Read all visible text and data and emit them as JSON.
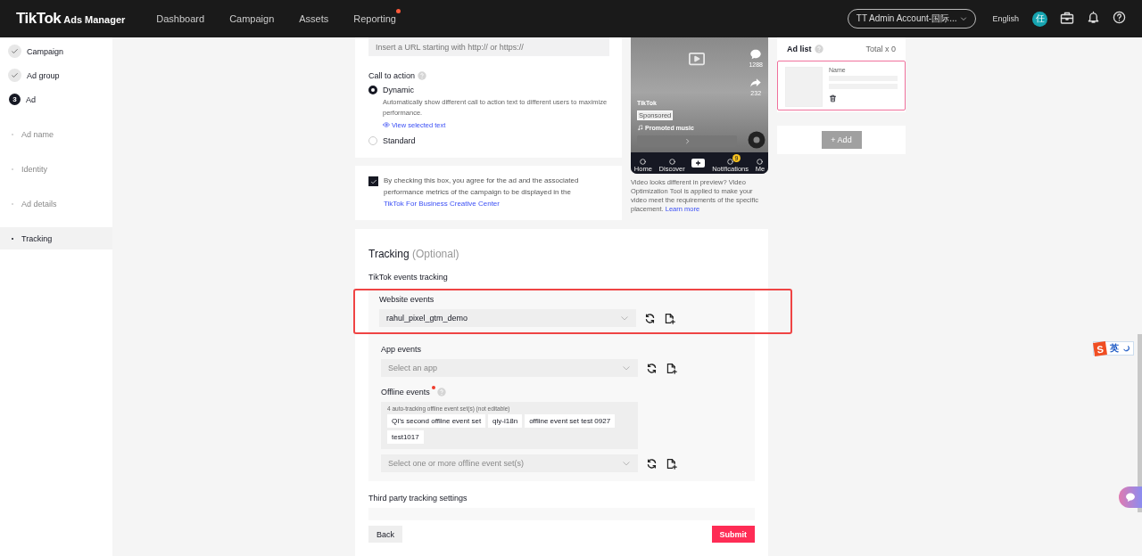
{
  "header": {
    "logo": "TikTok",
    "logo_suffix": "Ads Manager",
    "nav": [
      {
        "label": "Dashboard",
        "badge": false
      },
      {
        "label": "Campaign",
        "badge": false
      },
      {
        "label": "Assets",
        "badge": false
      },
      {
        "label": "Reporting",
        "badge": true
      }
    ],
    "account": "TT Admin Account-国际...",
    "language": "English",
    "avatar": "任"
  },
  "steps": [
    {
      "kind": "done",
      "label": "Campaign",
      "selected": false
    },
    {
      "kind": "done",
      "label": "Ad group",
      "selected": false
    },
    {
      "kind": "current",
      "number": "3",
      "label": "Ad",
      "selected": false
    },
    {
      "kind": "sub",
      "label": "Ad name",
      "selected": false
    },
    {
      "kind": "sub",
      "label": "Identity",
      "selected": false
    },
    {
      "kind": "sub",
      "label": "Ad details",
      "selected": false
    },
    {
      "kind": "sub",
      "label": "Tracking",
      "selected": true
    }
  ],
  "url_field": {
    "placeholder": "Insert a URL starting with http:// or https://"
  },
  "call_to_action": {
    "label": "Call to action",
    "options": [
      {
        "label": "Dynamic",
        "selected": true,
        "description": "Automatically show different call to action text to different users to maximize performance.",
        "link": "View selected text"
      },
      {
        "label": "Standard",
        "selected": false
      }
    ]
  },
  "consent": {
    "checked": true,
    "text": "By checking this box, you agree for the ad and the associated performance metrics of the campaign to be displayed in the",
    "link": "TikTok For Business Creative Center"
  },
  "preview": {
    "comments": "1288",
    "shares": "232",
    "account": "TikTok",
    "sponsored": "Sponsored",
    "music": "Promoted music",
    "tabs": [
      "Home",
      "Discover",
      "Notifications",
      "Me"
    ],
    "notification_count": "9",
    "caption": "Video looks different in preview? Video Optimization Tool is applied to make your video meet the requirements of the specific placement.",
    "caption_link": "Learn more"
  },
  "ad_list": {
    "title": "Ad list",
    "total": "Total x 0",
    "item_label": "Name",
    "add_button": "+ Add",
    "add_disabled": true
  },
  "tracking": {
    "title": "Tracking",
    "optional": "(Optional)",
    "subtitle": "TikTok events tracking",
    "website": {
      "label": "Website events",
      "value": "rahul_pixel_gtm_demo",
      "highlighted": true
    },
    "app": {
      "label": "App events",
      "placeholder": "Select an app"
    },
    "offline": {
      "label": "Offline events",
      "required": true,
      "note": "4 auto-tracking offline event set(s) (not editable)",
      "tags": [
        "QI's second offline event set",
        "qiy-i18n",
        "offline event set test 0927",
        "test1017"
      ],
      "placeholder": "Select one or more offline event set(s)"
    },
    "third_party": "Third party tracking settings"
  },
  "footer": {
    "back": "Back",
    "submit": "Submit"
  },
  "ime": {
    "logo": "S",
    "label": "英"
  }
}
